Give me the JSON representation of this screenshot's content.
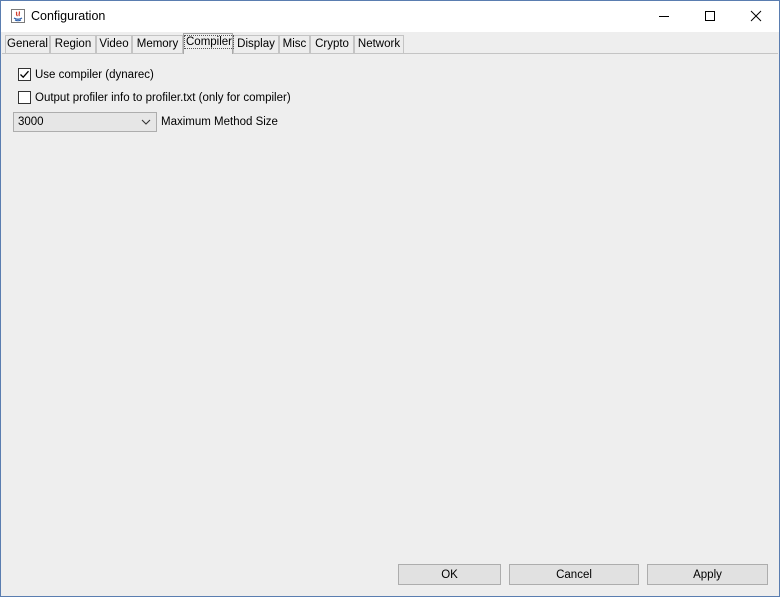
{
  "window": {
    "title": "Configuration"
  },
  "tabs": [
    {
      "label": "General"
    },
    {
      "label": "Region"
    },
    {
      "label": "Video"
    },
    {
      "label": "Memory"
    },
    {
      "label": "Compiler"
    },
    {
      "label": "Display"
    },
    {
      "label": "Misc"
    },
    {
      "label": "Crypto"
    },
    {
      "label": "Network"
    }
  ],
  "selected_tab": "Compiler",
  "compiler": {
    "use_compiler_label": "Use compiler (dynarec)",
    "use_compiler_checked": true,
    "profiler_label": "Output profiler info to profiler.txt (only for compiler)",
    "profiler_checked": false,
    "method_size_value": "3000",
    "method_size_label": "Maximum Method Size"
  },
  "buttons": {
    "ok": "OK",
    "cancel": "Cancel",
    "apply": "Apply"
  }
}
